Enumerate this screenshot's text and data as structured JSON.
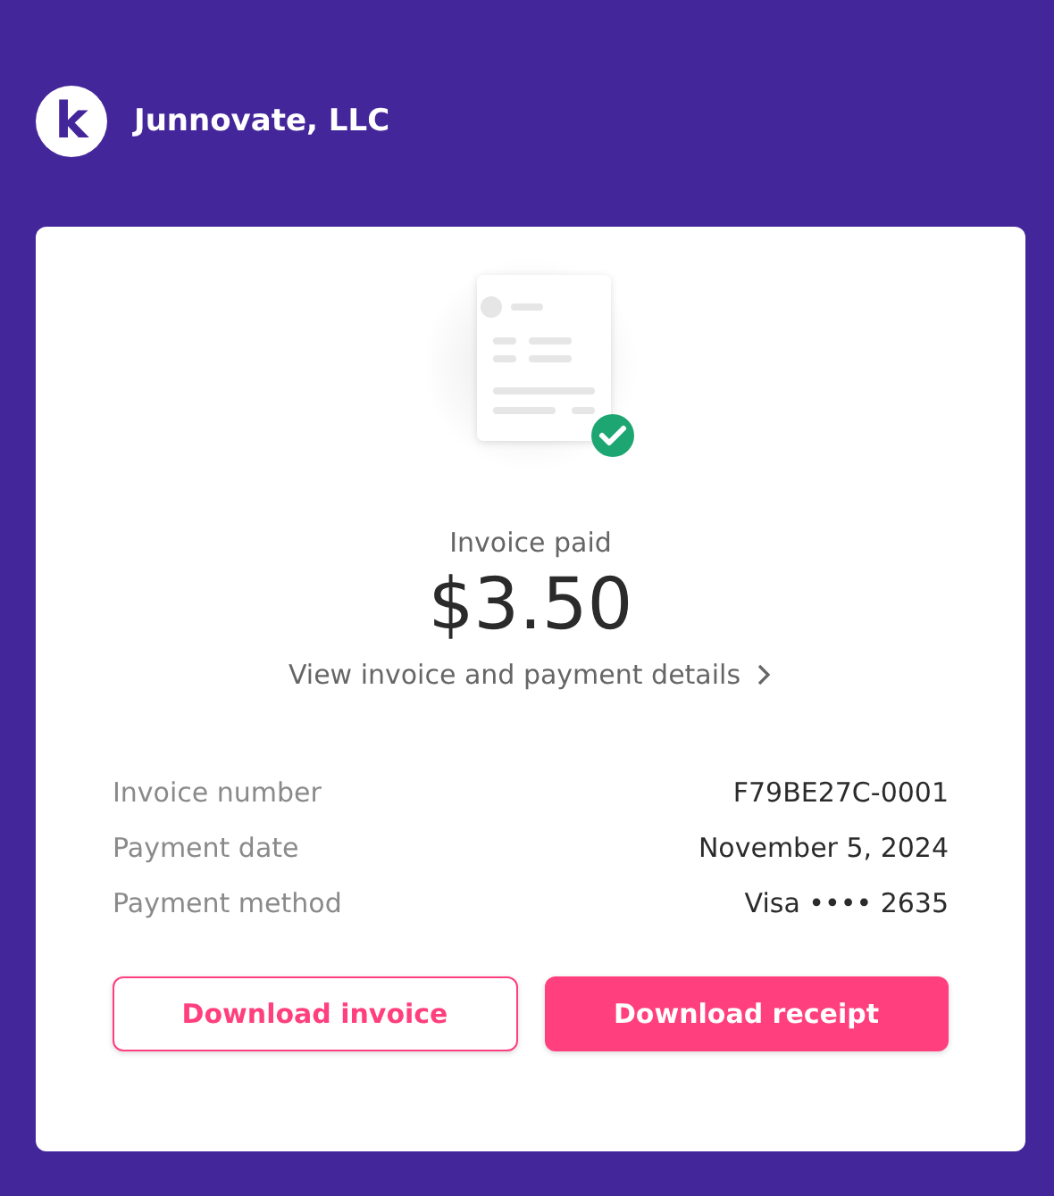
{
  "header": {
    "logo": "k",
    "company": "Junnovate, LLC"
  },
  "status": "Invoice paid",
  "amount": "$3.50",
  "details_link": "View invoice and payment details",
  "details": [
    {
      "label": "Invoice number",
      "value": "F79BE27C-0001"
    },
    {
      "label": "Payment date",
      "value": "November 5, 2024"
    },
    {
      "label": "Payment method",
      "value": "Visa •••• 2635"
    }
  ],
  "buttons": [
    {
      "label": "Download invoice",
      "kind": "outline"
    },
    {
      "label": "Download receipt",
      "kind": "filled"
    }
  ]
}
